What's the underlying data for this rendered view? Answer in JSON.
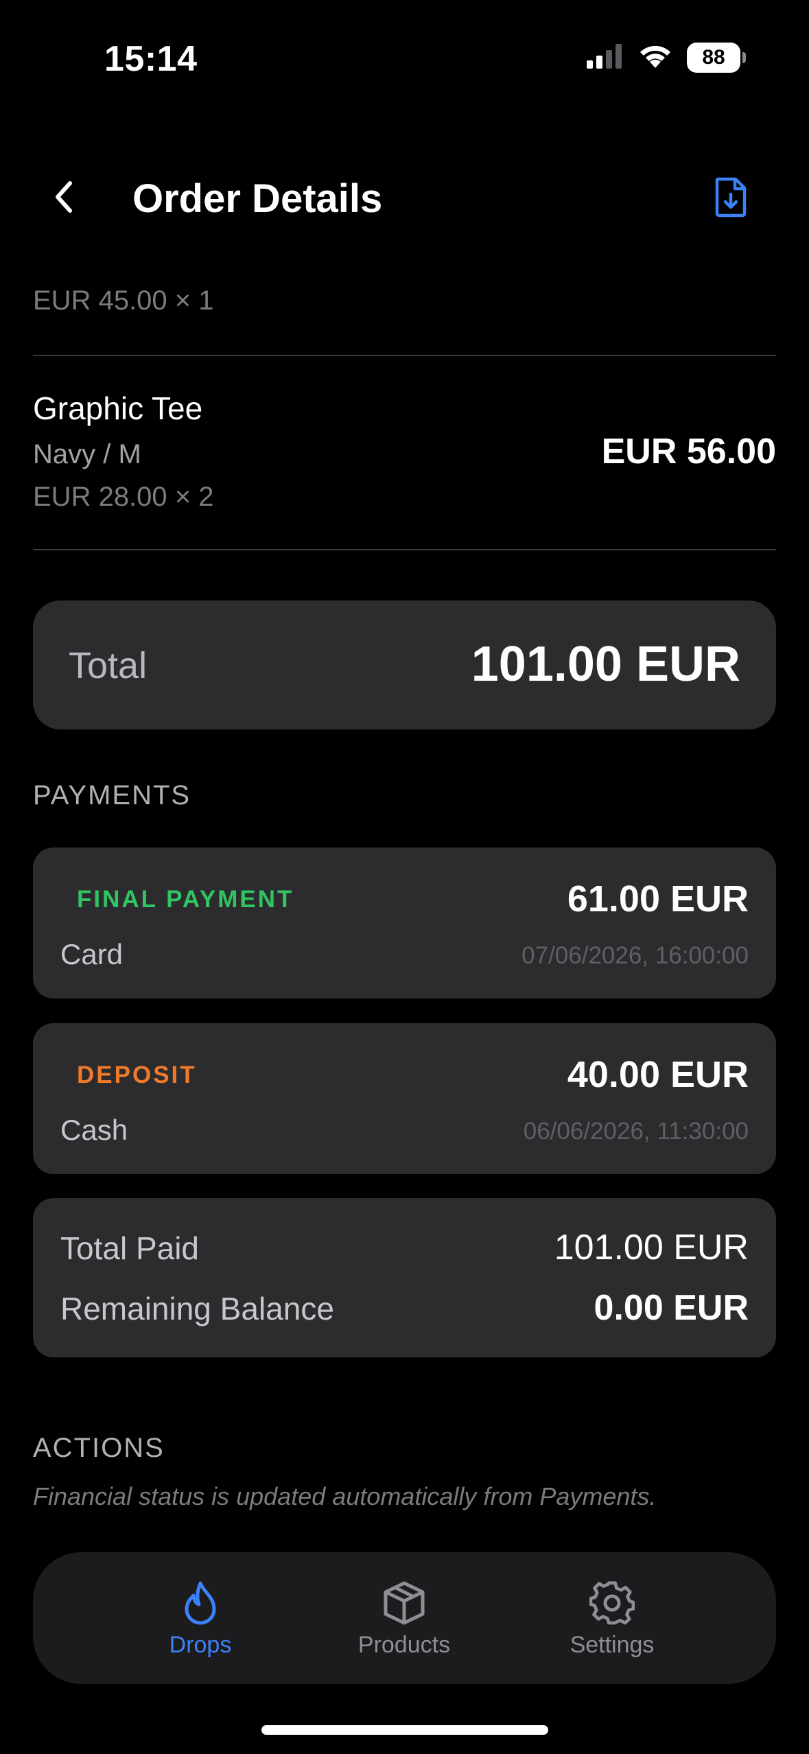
{
  "status_bar": {
    "time": "15:14",
    "battery": "88"
  },
  "nav": {
    "title": "Order Details",
    "back_icon": "chevron-left-icon",
    "export_icon": "document-download-icon"
  },
  "items": {
    "previous_price_line": "EUR 45.00 × 1",
    "graphic_tee": {
      "name": "Graphic Tee",
      "variant": "Navy / M",
      "price_line": "EUR 28.00 × 2",
      "line_total": "EUR 56.00"
    }
  },
  "total": {
    "label": "Total",
    "value": "101.00 EUR"
  },
  "payments": {
    "header": "PAYMENTS",
    "list": [
      {
        "type": "FINAL PAYMENT",
        "type_color": "#30c463",
        "amount": "61.00 EUR",
        "method": "Card",
        "date": "07/06/2026, 16:00:00"
      },
      {
        "type": "DEPOSIT",
        "type_color": "#f07a2a",
        "amount": "40.00 EUR",
        "method": "Cash",
        "date": "06/06/2026, 11:30:00"
      }
    ],
    "summary": {
      "total_paid_label": "Total Paid",
      "total_paid_value": "101.00 EUR",
      "remaining_label": "Remaining Balance",
      "remaining_value": "0.00 EUR"
    }
  },
  "actions": {
    "header": "ACTIONS",
    "note": "Financial status is updated automatically from Payments."
  },
  "tab_bar": {
    "active_color": "#3b82f6",
    "inactive_color": "#8e8e93",
    "tabs": [
      {
        "label": "Drops",
        "icon": "flame-icon",
        "active": true
      },
      {
        "label": "Products",
        "icon": "box-icon",
        "active": false
      },
      {
        "label": "Settings",
        "icon": "gear-icon",
        "active": false
      }
    ]
  }
}
